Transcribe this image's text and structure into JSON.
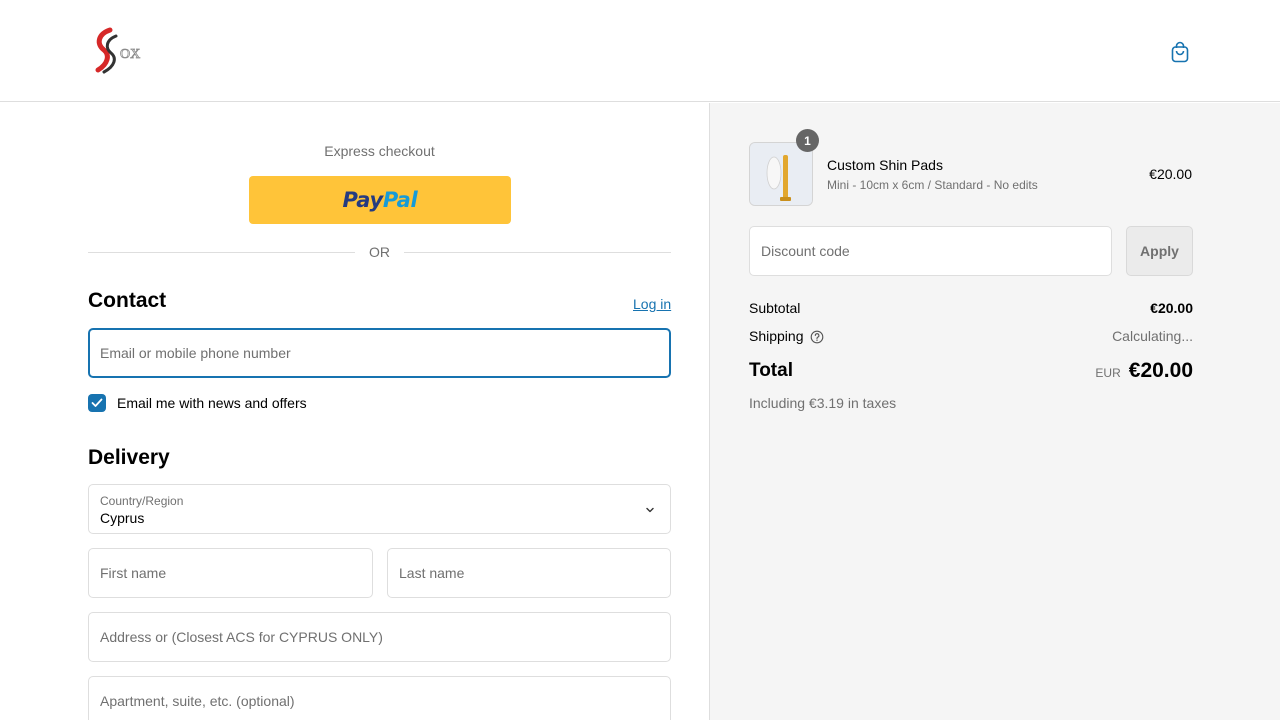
{
  "header": {
    "logo_text": "OX",
    "cart_icon": "shopping-bag-icon"
  },
  "express": {
    "label": "Express checkout",
    "paypal_pay": "Pay",
    "paypal_pal": "Pal",
    "or_text": "OR"
  },
  "contact": {
    "title": "Contact",
    "login_label": "Log in",
    "email_placeholder": "Email or mobile phone number",
    "newsletter_label": "Email me with news and offers",
    "newsletter_checked": true
  },
  "delivery": {
    "title": "Delivery",
    "country_label": "Country/Region",
    "country_value": "Cyprus",
    "first_name_placeholder": "First name",
    "last_name_placeholder": "Last name",
    "address_placeholder": "Address or (Closest ACS for CYPRUS ONLY)",
    "apartment_placeholder": "Apartment, suite, etc. (optional)"
  },
  "order": {
    "item": {
      "quantity": "1",
      "name": "Custom Shin Pads",
      "variant": "Mini - 10cm x 6cm / Standard - No edits",
      "price": "€20.00"
    },
    "discount_placeholder": "Discount code",
    "apply_label": "Apply",
    "subtotal_label": "Subtotal",
    "subtotal_value": "€20.00",
    "shipping_label": "Shipping",
    "shipping_value": "Calculating...",
    "total_label": "Total",
    "total_currency": "EUR",
    "total_value": "€20.00",
    "taxes_note": "Including €3.19 in taxes"
  },
  "colors": {
    "accent": "#1773b0",
    "paypal_yellow": "#ffc439",
    "summary_bg": "#f5f5f5"
  }
}
